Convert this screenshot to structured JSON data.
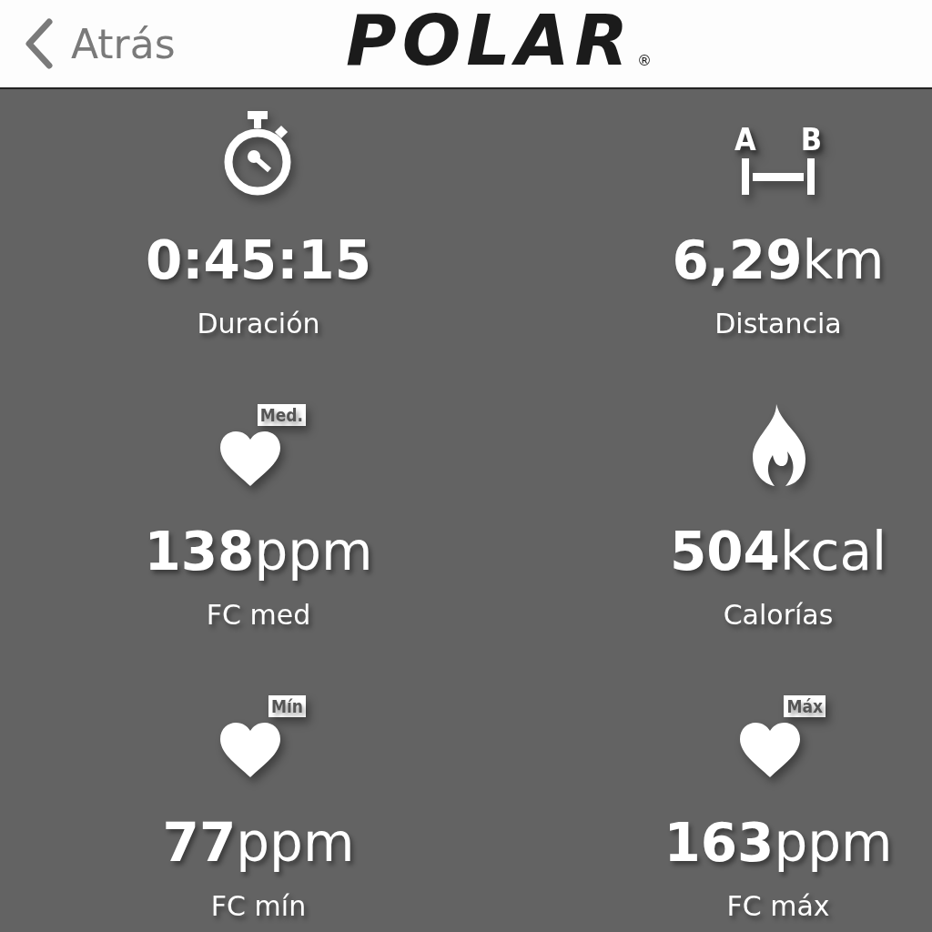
{
  "header": {
    "back_label": "Atrás",
    "logo": "POLAR",
    "logo_mark": "®"
  },
  "metric_rows": [
    [
      {
        "kind": "stopwatch",
        "value": "0:45:15",
        "label": "Duración"
      },
      {
        "kind": "distance",
        "badge_start": "A",
        "badge_end": "B",
        "value": "6,29",
        "unit": "km",
        "label": "Distancia"
      }
    ],
    [
      {
        "kind": "heart",
        "badge": "Med.",
        "value": "138",
        "unit": "ppm",
        "label": "FC med"
      },
      {
        "kind": "flame",
        "value": "504",
        "unit": "kcal",
        "label": "Calorías"
      }
    ],
    [
      {
        "kind": "heart",
        "badge": "Mín",
        "value": "77",
        "unit": "ppm",
        "label": "FC mín"
      },
      {
        "kind": "heart",
        "badge": "Máx",
        "value": "163",
        "unit": "ppm",
        "label": "FC máx"
      }
    ]
  ]
}
